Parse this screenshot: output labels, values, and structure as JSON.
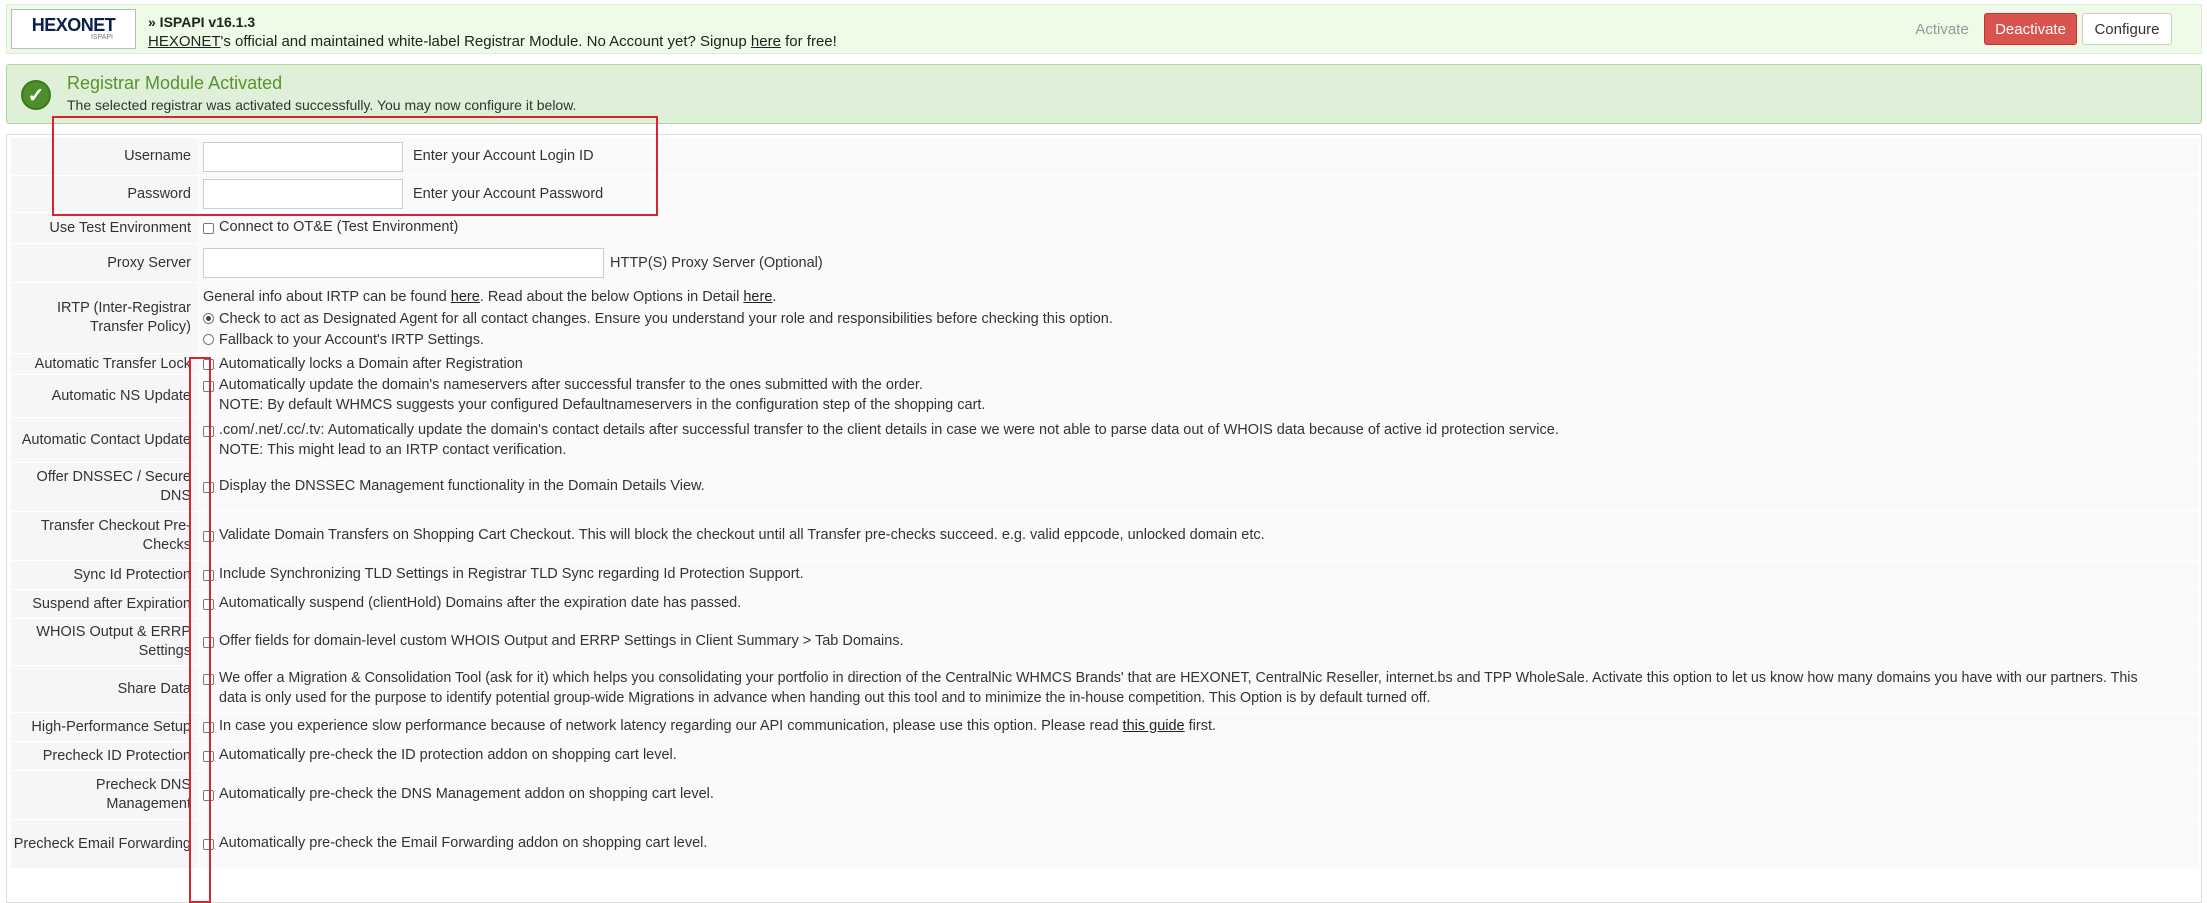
{
  "header": {
    "logo_text": "HEXONET",
    "logo_sub": "ISPAPI",
    "module_title": "» ISPAPI v16.1.3",
    "desc_link": "HEXONET",
    "desc_text": "'s official and maintained white-label Registrar Module. No Account yet? Signup ",
    "signup_link": "here",
    "desc_end": " for free!",
    "activate_label": "Activate",
    "deactivate_label": "Deactivate",
    "configure_label": "Configure"
  },
  "alert": {
    "icon": "checkmark-icon",
    "title": "Registrar Module Activated",
    "text": "The selected registrar was activated successfully. You may now configure it below."
  },
  "form": {
    "username": {
      "label": "Username",
      "value": "",
      "hint": "Enter your Account Login ID"
    },
    "password": {
      "label": "Password",
      "value": "",
      "hint": "Enter your Account Password"
    },
    "test_env": {
      "label": "Use Test Environment",
      "checked": false,
      "text": "Connect to OT&E (Test Environment)"
    },
    "proxy": {
      "label": "Proxy Server",
      "value": "",
      "hint": "HTTP(S) Proxy Server (Optional)"
    },
    "irtp": {
      "label": "IRTP (Inter-Registrar Transfer Policy)",
      "info_a": "General info about IRTP can be found ",
      "link1": "here",
      "info_b": ". Read about the below Options in Detail ",
      "link2": "here",
      "info_c": ".",
      "option1": "Check to act as Designated Agent for all contact changes. Ensure you understand your role and responsibilities before checking this option.",
      "option2": "Fallback to your Account's IRTP Settings.",
      "selected": "option1"
    },
    "auto_transfer_lock": {
      "label": "Automatic Transfer Lock",
      "checked": false,
      "text": "Automatically locks a Domain after Registration"
    },
    "auto_ns_update": {
      "label": "Automatic NS Update",
      "checked": false,
      "text": "Automatically update the domain's nameservers after successful transfer to the ones submitted with the order.",
      "note": "NOTE: By default WHMCS suggests your configured Defaultnameservers in the configuration step of the shopping cart."
    },
    "auto_contact_update": {
      "label": "Automatic Contact Update",
      "checked": false,
      "text": ".com/.net/.cc/.tv: Automatically update the domain's contact details after successful transfer to the client details in case we were not able to parse data out of WHOIS data because of active id protection service.",
      "note": "NOTE: This might lead to an IRTP contact verification."
    },
    "dnssec": {
      "label": "Offer DNSSEC / Secure DNS",
      "checked": false,
      "text": "Display the DNSSEC Management functionality in the Domain Details View."
    },
    "transfer_prechecks": {
      "label": "Transfer Checkout Pre-Checks",
      "checked": false,
      "text": "Validate Domain Transfers on Shopping Cart Checkout. This will block the checkout until all Transfer pre-checks succeed. e.g. valid eppcode, unlocked domain etc."
    },
    "sync_id_protection": {
      "label": "Sync Id Protection",
      "checked": false,
      "text": "Include Synchronizing TLD Settings in Registrar TLD Sync regarding Id Protection Support."
    },
    "suspend_after_expiration": {
      "label": "Suspend after Expiration",
      "checked": false,
      "text": "Automatically suspend (clientHold) Domains after the expiration date has passed."
    },
    "whois_errp": {
      "label": "WHOIS Output & ERRP Settings",
      "checked": false,
      "text": "Offer fields for domain-level custom WHOIS Output and ERRP Settings in Client Summary > Tab Domains."
    },
    "share_data": {
      "label": "Share Data",
      "checked": false,
      "text1": "We offer a Migration & Consolidation Tool (ask for it) which helps you consolidating your portfolio in direction of the CentralNic WHMCS Brands' that are HEXONET, CentralNic Reseller, internet.bs and TPP WholeSale. Activate this option to let us know how many domains you have with our partners. This",
      "text2": "data is only used for the purpose to identify potential group-wide Migrations in advance when handing out this tool and to minimize the in-house competition. This Option is by default turned off."
    },
    "high_performance": {
      "label": "High-Performance Setup",
      "checked": false,
      "text_a": "In case you experience slow performance because of network latency regarding our API communication, please use this option. Please read ",
      "link": "this guide",
      "text_b": " first."
    },
    "precheck_id_protection": {
      "label": "Precheck ID Protection",
      "checked": false,
      "text": "Automatically pre-check the ID protection addon on shopping cart level."
    },
    "precheck_dns": {
      "label": "Precheck DNS Management",
      "checked": false,
      "text": "Automatically pre-check the DNS Management addon on shopping cart level."
    },
    "precheck_email": {
      "label": "Precheck Email Forwarding",
      "checked": false,
      "text": "Automatically pre-check the Email Forwarding addon on shopping cart level."
    }
  },
  "colors": {
    "topbar_bg": "#eefbe6",
    "alert_bg": "#dff0d8",
    "alert_title": "#58932c",
    "deactivate": "#d9534f",
    "highlight": "#d9232f"
  }
}
